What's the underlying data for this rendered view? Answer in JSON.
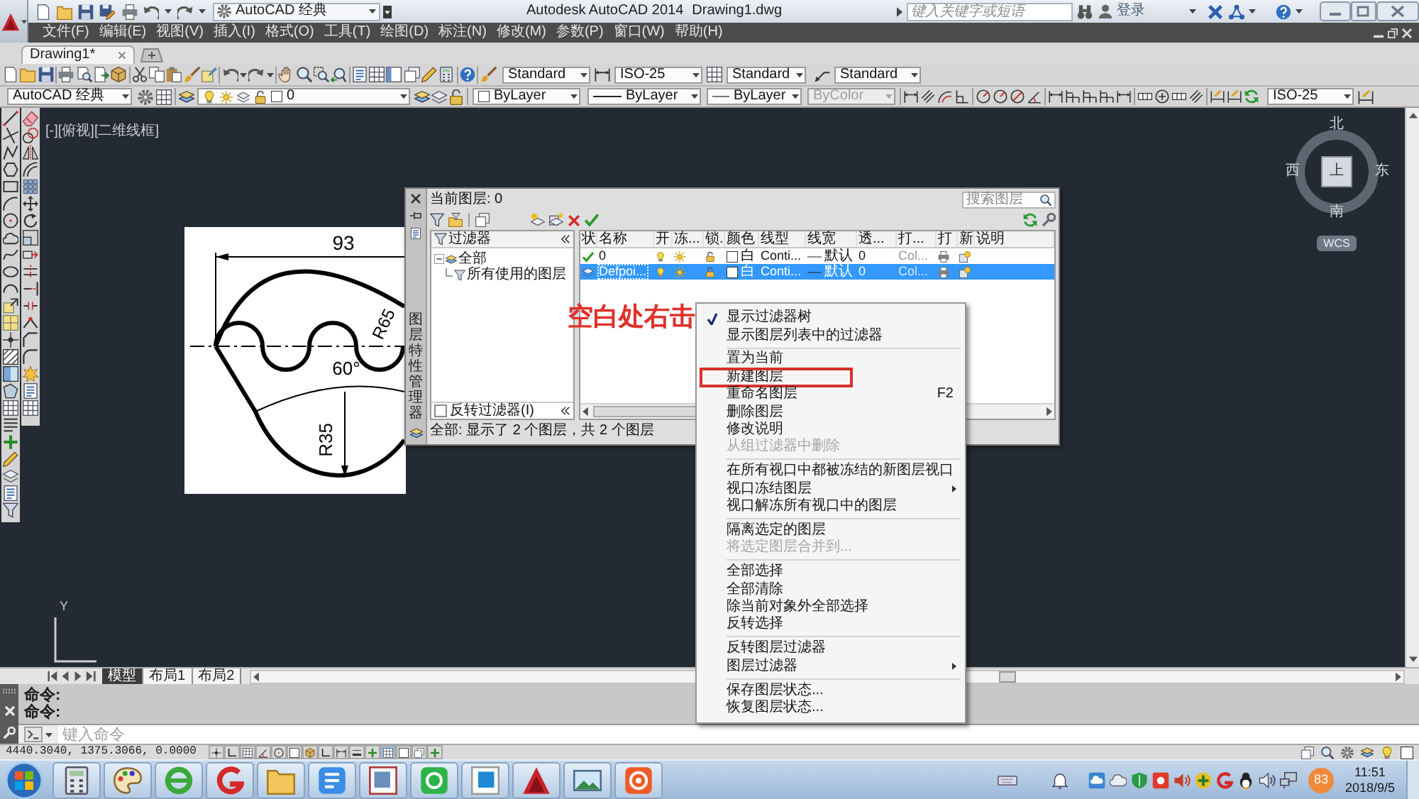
{
  "title_bar": {
    "workspace": "AutoCAD 经典",
    "title": "Autodesk AutoCAD 2014",
    "document": "Drawing1.dwg",
    "search": {
      "placeholder": "键入关键字或短语"
    },
    "sign_in": "登录"
  },
  "menu_bar": [
    "文件(F)",
    "编辑(E)",
    "视图(V)",
    "插入(I)",
    "格式(O)",
    "工具(T)",
    "绘图(D)",
    "标注(N)",
    "修改(M)",
    "参数(P)",
    "窗口(W)",
    "帮助(H)"
  ],
  "document_tabs": [
    {
      "label": "Drawing1*",
      "selected": true
    }
  ],
  "styles_toolbar": {
    "text_style": "Standard",
    "dimension_style": "ISO-25",
    "table_style": "Standard",
    "multileader_style": "Standard"
  },
  "properties_toolbar": {
    "workspace": "AutoCAD 经典",
    "layer": "0",
    "dropdowns": [
      {
        "kind": "color",
        "value": "ByLayer",
        "disabled": false
      },
      {
        "kind": "linetype",
        "value": "ByLayer",
        "disabled": false
      },
      {
        "kind": "lineweight",
        "value": "ByLayer",
        "disabled": false
      },
      {
        "kind": "plot_style",
        "value": "ByColor",
        "disabled": true
      }
    ],
    "dimension_style": "ISO-25"
  },
  "viewport": {
    "label": "[-][俯视][二维线框]"
  },
  "viewcube": {
    "north": "北",
    "south": "南",
    "west": "西",
    "east": "东",
    "face": "上",
    "coordinate_system": "WCS"
  },
  "ucs_icon": {
    "y_label": "Y"
  },
  "part_image": {
    "labels": [
      "93",
      "R65",
      "60°",
      "R35"
    ]
  },
  "layer_manager": {
    "title": "图层特性管理器",
    "current_layer": "当前图层: 0",
    "search": {
      "placeholder": "搜索图层"
    },
    "filter_panel": {
      "header": "过滤器",
      "tree": [
        {
          "label": "全部",
          "expanded": true,
          "children": [
            {
              "label": "所有使用的图层"
            }
          ]
        }
      ],
      "invert_filter": {
        "label": "反转过滤器(I)",
        "checked": false
      }
    },
    "columns": [
      "状",
      "名称",
      "开",
      "冻...",
      "锁.",
      "颜色",
      "线型",
      "线宽",
      "透...",
      "打...",
      "打",
      "新",
      "说明"
    ],
    "rows": [
      {
        "current": true,
        "selected": false,
        "name": "0",
        "color_name": "白",
        "linetype": "Conti...",
        "lineweight": "默认",
        "transparency": "0",
        "plot_style": "Col..."
      },
      {
        "current": false,
        "selected": true,
        "name": "Defpoi...",
        "color_name": "白",
        "linetype": "Conti...",
        "lineweight": "默认",
        "transparency": "0",
        "plot_style": "Col..."
      }
    ],
    "status": "全部: 显示了 2 个图层，共 2 个图层"
  },
  "annotation": "空白处右击",
  "context_menu": {
    "sections": [
      [
        {
          "label": "显示过滤器树",
          "checked": true,
          "disabled": false,
          "submenu": false,
          "framed": false
        },
        {
          "label": "显示图层列表中的过滤器",
          "checked": false,
          "disabled": false,
          "submenu": false,
          "framed": false
        }
      ],
      [
        {
          "label": "置为当前",
          "checked": false,
          "disabled": false,
          "submenu": false,
          "framed": false
        },
        {
          "label": "新建图层",
          "checked": false,
          "disabled": false,
          "submenu": false,
          "framed": true
        },
        {
          "label": "重命名图层",
          "shortcut": "F2",
          "checked": false,
          "disabled": false,
          "submenu": false,
          "framed": false
        },
        {
          "label": "删除图层",
          "checked": false,
          "disabled": false,
          "submenu": false,
          "framed": false
        },
        {
          "label": "修改说明",
          "checked": false,
          "disabled": false,
          "submenu": false,
          "framed": false
        },
        {
          "label": "从组过滤器中删除",
          "checked": false,
          "disabled": true,
          "submenu": false,
          "framed": false
        }
      ],
      [
        {
          "label": "在所有视口中都被冻结的新图层视口",
          "checked": false,
          "disabled": false,
          "submenu": false,
          "framed": false
        },
        {
          "label": "视口冻结图层",
          "checked": false,
          "disabled": false,
          "submenu": true,
          "framed": false
        },
        {
          "label": "视口解冻所有视口中的图层",
          "checked": false,
          "disabled": false,
          "submenu": false,
          "framed": false
        }
      ],
      [
        {
          "label": "隔离选定的图层",
          "checked": false,
          "disabled": false,
          "submenu": false,
          "framed": false
        },
        {
          "label": "将选定图层合并到...",
          "checked": false,
          "disabled": true,
          "submenu": false,
          "framed": false
        }
      ],
      [
        {
          "label": "全部选择",
          "checked": false,
          "disabled": false,
          "submenu": false,
          "framed": false
        },
        {
          "label": "全部清除",
          "checked": false,
          "disabled": false,
          "submenu": false,
          "framed": false
        },
        {
          "label": "除当前对象外全部选择",
          "checked": false,
          "disabled": false,
          "submenu": false,
          "framed": false
        },
        {
          "label": "反转选择",
          "checked": false,
          "disabled": false,
          "submenu": false,
          "framed": false
        }
      ],
      [
        {
          "label": "反转图层过滤器",
          "checked": false,
          "disabled": false,
          "submenu": false,
          "framed": false
        },
        {
          "label": "图层过滤器",
          "checked": false,
          "disabled": false,
          "submenu": true,
          "framed": false
        }
      ],
      [
        {
          "label": "保存图层状态...",
          "checked": false,
          "disabled": false,
          "submenu": false,
          "framed": false
        },
        {
          "label": "恢复图层状态...",
          "checked": false,
          "disabled": false,
          "submenu": false,
          "framed": false
        }
      ]
    ]
  },
  "layout_tabs": [
    {
      "label": "模型",
      "selected": true
    },
    {
      "label": "布局1",
      "selected": false
    },
    {
      "label": "布局2",
      "selected": false
    }
  ],
  "command_line": {
    "history": [
      "命令:",
      "命令:"
    ],
    "input": {
      "placeholder": "键入命令"
    }
  },
  "status_bar": {
    "coordinates": "4440.3040, 1375.3066, 0.0000",
    "toggles": [
      {
        "on": false
      },
      {
        "on": false
      },
      {
        "on": false
      },
      {
        "on": false
      },
      {
        "on": false
      },
      {
        "on": false
      },
      {
        "on": false
      },
      {
        "on": false
      },
      {
        "on": false
      },
      {
        "on": false
      },
      {
        "on": false
      },
      {
        "on": true
      },
      {
        "on": false
      },
      {
        "on": false
      },
      {
        "on": false
      }
    ]
  },
  "taskbar": {
    "badge": "83",
    "time": "11:51",
    "date": "2018/9/5"
  }
}
